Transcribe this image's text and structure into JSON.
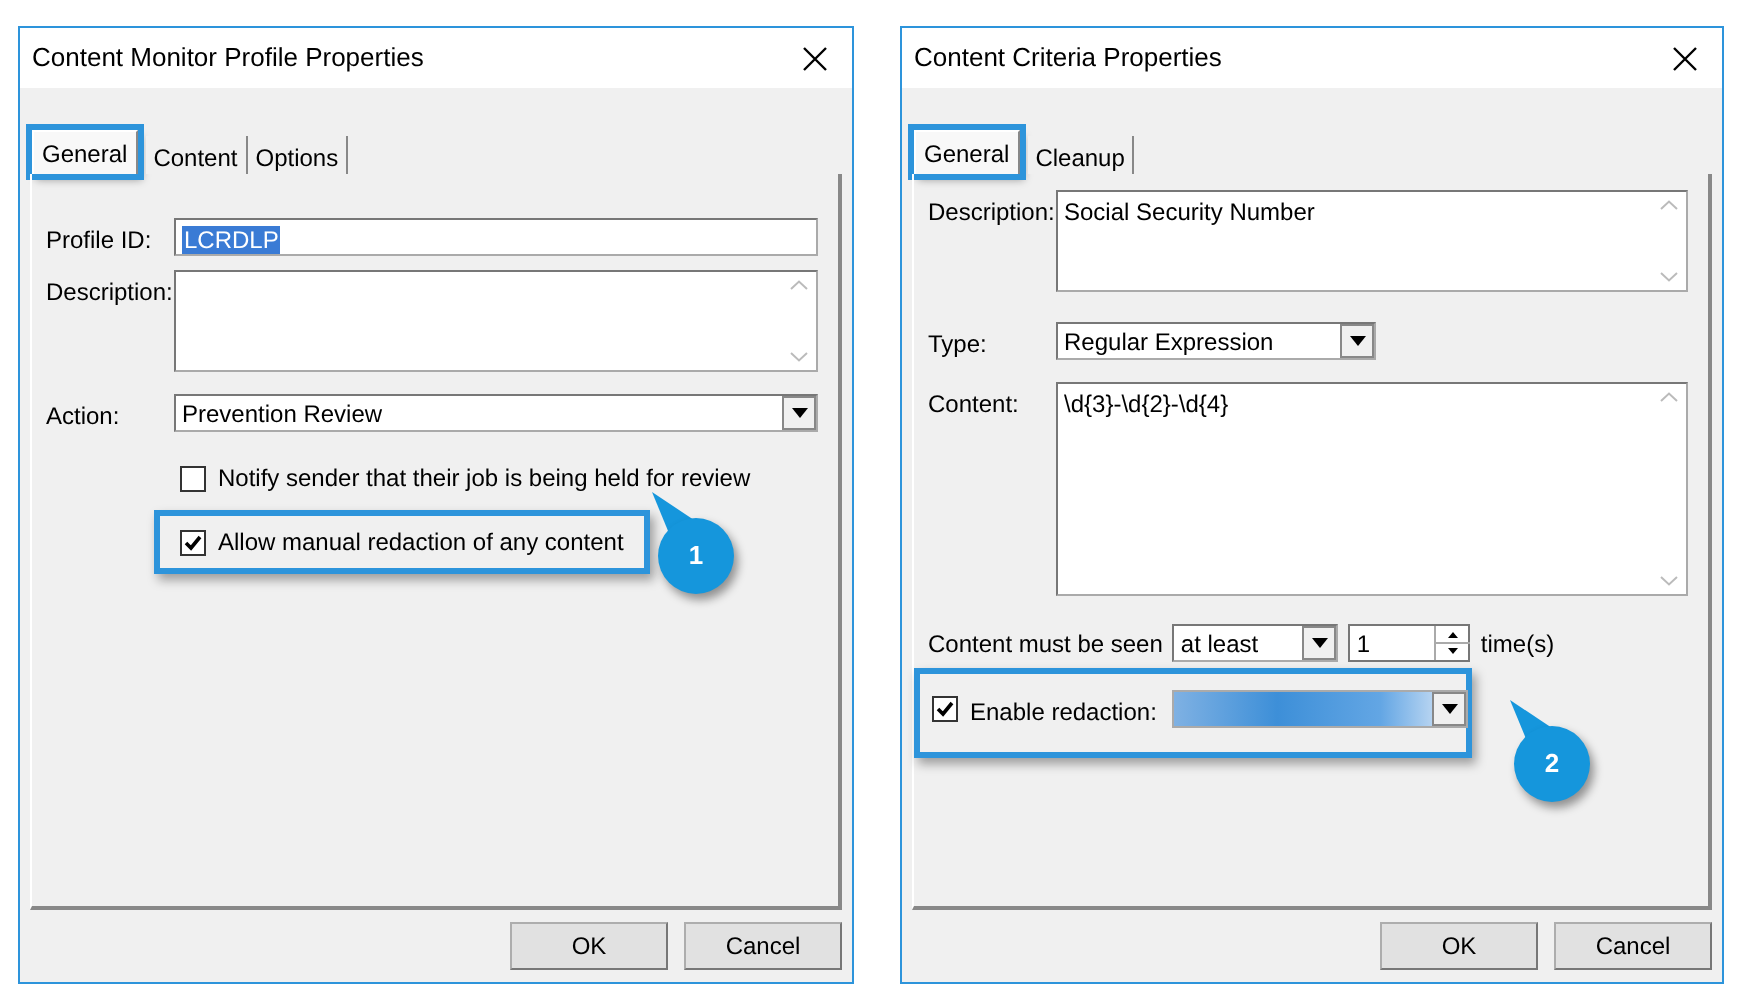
{
  "dialogs": [
    {
      "title": "Content Monitor Profile Properties",
      "tabs": [
        {
          "label": "General",
          "selected": true,
          "highlighted": true
        },
        {
          "label": "Content",
          "selected": false,
          "highlighted": false
        },
        {
          "label": "Options",
          "selected": false,
          "highlighted": false
        }
      ],
      "fields": [
        {
          "kind": "text",
          "label": "Profile ID:",
          "value": "LCRDLP",
          "text_selected": true
        },
        {
          "kind": "textarea",
          "label": "Description:"
        },
        {
          "kind": "select",
          "label": "Action:",
          "value": "Prevention Review"
        },
        {
          "kind": "checkbox",
          "label": "Notify sender that their job is being held for review",
          "checked": false,
          "highlighted": false
        },
        {
          "kind": "checkbox",
          "label": "Allow manual redaction of any content",
          "checked": true,
          "highlighted": true
        }
      ],
      "callout": "1",
      "buttons": [
        "OK",
        "Cancel"
      ]
    },
    {
      "title": "Content Criteria Properties",
      "tabs": [
        {
          "label": "General",
          "selected": true,
          "highlighted": true
        },
        {
          "label": "Cleanup",
          "selected": false,
          "highlighted": false
        }
      ],
      "fields": [
        {
          "kind": "textarea",
          "label": "Description:",
          "value": "Social Security Number"
        },
        {
          "kind": "select",
          "label": "Type:",
          "value": "Regular Expression"
        },
        {
          "kind": "large-textarea",
          "label": "Content:",
          "value": "\\d{3}-\\d{2}-\\d{4}"
        },
        {
          "kind": "count",
          "label": "Content must be seen",
          "qualifier": "at least",
          "count": "1",
          "unit": "time(s)"
        },
        {
          "kind": "redaction",
          "label": "Enable redaction:",
          "checked": true,
          "highlighted": true,
          "value_blurred": true
        }
      ],
      "callout": "2",
      "buttons": [
        "OK",
        "Cancel"
      ]
    }
  ]
}
